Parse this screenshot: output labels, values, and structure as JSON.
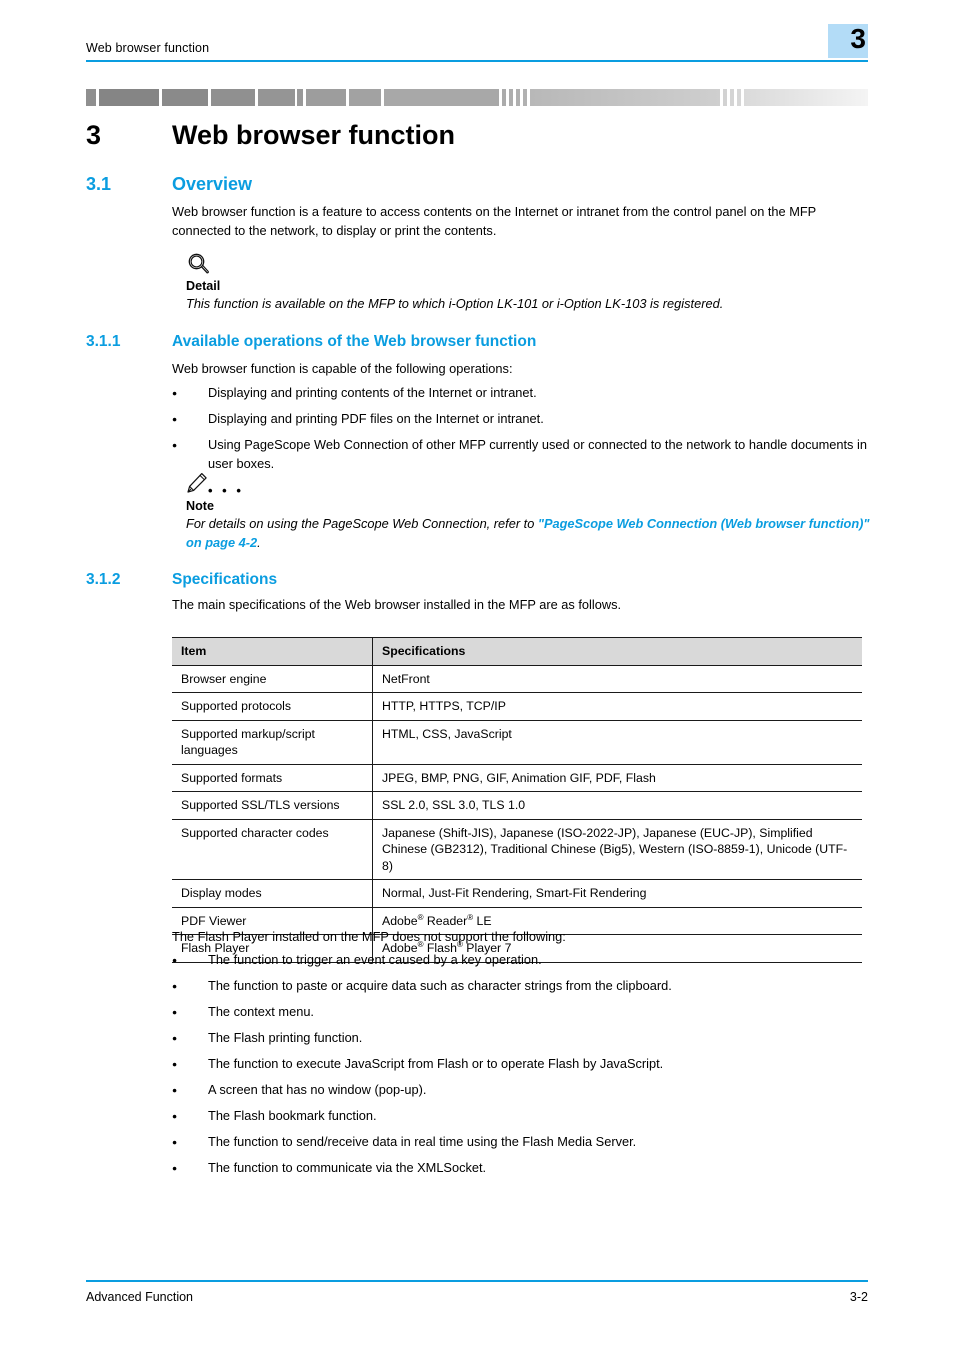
{
  "header": {
    "title": "Web browser function",
    "chapter_badge": "3",
    "rule_color": "#0a9de0",
    "badge_color": "#b3dcf7"
  },
  "chapter": {
    "number": "3",
    "title": "Web browser function"
  },
  "sections": {
    "overview": {
      "number": "3.1",
      "title": "Overview",
      "paragraph": "Web browser function is a feature to access contents on the Internet or intranet from the control panel on the MFP connected to the network, to display or print the contents."
    },
    "detail_callout": {
      "icon": "magnifier-icon",
      "label": "Detail",
      "body": "This function is available on the MFP to which i-Option LK-101 or i-Option LK-103 is registered."
    },
    "available_operations": {
      "number": "3.1.1",
      "title": "Available operations of the Web browser function",
      "intro": "Web browser function is capable of the following operations:",
      "bullets": [
        "Displaying and printing contents of the Internet or intranet.",
        "Displaying and printing PDF files on the Internet or intranet.",
        "Using PageScope Web Connection of other MFP currently used or connected to the network to handle documents in user boxes."
      ]
    },
    "note_callout": {
      "icon": "pencil-icon",
      "dots": "• • •",
      "label": "Note",
      "body_lead": "For details on using the PageScope Web Connection, refer to ",
      "body_link": "\"PageScope Web Connection (Web browser function)\" on page 4-2",
      "body_tail": ".",
      "link_color": "#0a9de0"
    },
    "specifications": {
      "number": "3.1.2",
      "title": "Specifications",
      "intro": "The main specifications of the Web browser installed in the MFP are as follows.",
      "table": {
        "headers": [
          "Item",
          "Specifications"
        ],
        "rows": [
          [
            "Browser engine",
            "NetFront"
          ],
          [
            "Supported protocols",
            "HTTP, HTTPS, TCP/IP"
          ],
          [
            "Supported markup/script languages",
            "HTML, CSS, JavaScript"
          ],
          [
            "Supported formats",
            "JPEG, BMP, PNG, GIF, Animation GIF, PDF, Flash"
          ],
          [
            "Supported SSL/TLS versions",
            "SSL 2.0, SSL 3.0, TLS 1.0"
          ],
          [
            "Supported character codes",
            "Japanese (Shift-JIS), Japanese (ISO-2022-JP), Japanese (EUC-JP), Simplified Chinese (GB2312), Traditional Chinese (Big5), Western (ISO-8859-1), Unicode (UTF-8)"
          ],
          [
            "Display modes",
            "Normal, Just-Fit Rendering, Smart-Fit Rendering"
          ],
          [
            "PDF Viewer",
            "Adobe® Reader® LE"
          ],
          [
            "Flash Player",
            "Adobe® Flash® Player 7"
          ]
        ]
      },
      "unsupported_intro": "The Flash Player installed on the MFP does not support the following:",
      "unsupported_bullets": [
        "The function to trigger an event caused by a key operation.",
        "The function to paste or acquire data such as character strings from the clipboard.",
        "The context menu.",
        "The Flash printing function.",
        "The function to execute JavaScript from Flash or to operate Flash by JavaScript.",
        "A screen that has no window (pop-up).",
        "The Flash bookmark function.",
        "The function to send/receive data in real time using the Flash Media Server.",
        "The function to communicate via the XMLSocket."
      ]
    }
  },
  "footer": {
    "left": "Advanced Function",
    "right": "3-2"
  }
}
